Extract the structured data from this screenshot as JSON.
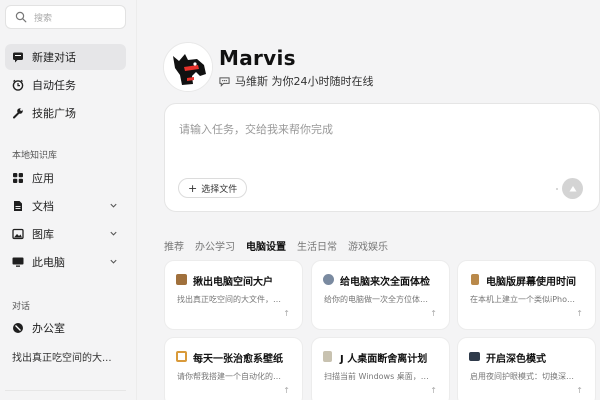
{
  "sidebar": {
    "search_placeholder": "搜索",
    "nav": [
      {
        "label": "新建对话",
        "icon": "chat-icon",
        "active": true
      },
      {
        "label": "自动任务",
        "icon": "clock-icon"
      },
      {
        "label": "技能广场",
        "icon": "wrench-icon"
      }
    ],
    "kb_title": "本地知识库",
    "kb_items": [
      {
        "label": "应用",
        "icon": "apps-grid-icon"
      },
      {
        "label": "文档",
        "icon": "document-icon"
      },
      {
        "label": "图库",
        "icon": "image-icon"
      },
      {
        "label": "此电脑",
        "icon": "monitor-icon"
      }
    ],
    "conv_title": "对话",
    "conv_items": [
      {
        "label": "办公室",
        "icon": "office-icon"
      }
    ],
    "recent_conversation": "找出真正吃空间的大..."
  },
  "header": {
    "app_name": "Marvis",
    "tagline": "马维斯 为你24小时随时在线",
    "tagline_icon": "speech-bubble-icon"
  },
  "composer": {
    "placeholder": "请输入任务，交给我来帮你完成",
    "choose_file_label": "选择文件",
    "choose_file_icon": "plus-icon",
    "send_icon": "arrow-up-icon"
  },
  "tabs": [
    {
      "label": "推荐"
    },
    {
      "label": "办公学习"
    },
    {
      "label": "电脑设置",
      "active": true
    },
    {
      "label": "生活日常"
    },
    {
      "label": "游戏娱乐"
    }
  ],
  "cards": [
    {
      "title": "揪出电脑空间大户",
      "desc": "找出真正吃空间的大文件，…",
      "icon": "box-icon",
      "icon_color": "#a0703c"
    },
    {
      "title": "给电脑来次全面体检",
      "desc": "给你的电脑做一次全方位体…",
      "icon": "stethoscope-icon",
      "icon_color": "#7a8aa0"
    },
    {
      "title": "电脑版屏幕使用时间",
      "desc": "在本机上建立一个类似iPho…",
      "icon": "hourglass-icon",
      "icon_color": "#b9894a"
    },
    {
      "title": "每天一张治愈系壁纸",
      "desc": "请你帮我搭建一个自动化的…",
      "icon": "frame-icon",
      "icon_color": "#d99a3a"
    },
    {
      "title": "J 人桌面断舍离计划",
      "desc": "扫描当前 Windows 桌面，…",
      "icon": "notepad-icon",
      "icon_color": "#c8c2b0"
    },
    {
      "title": "开启深色模式",
      "desc": "启用夜间护眼模式：切换深…",
      "icon": "dark-window-icon",
      "icon_color": "#2f3a4a"
    }
  ],
  "colors": {
    "background": "#f4f4f5",
    "card": "#ffffff",
    "active_nav": "#e6e6e8",
    "send_button": "#d4d4d4"
  }
}
